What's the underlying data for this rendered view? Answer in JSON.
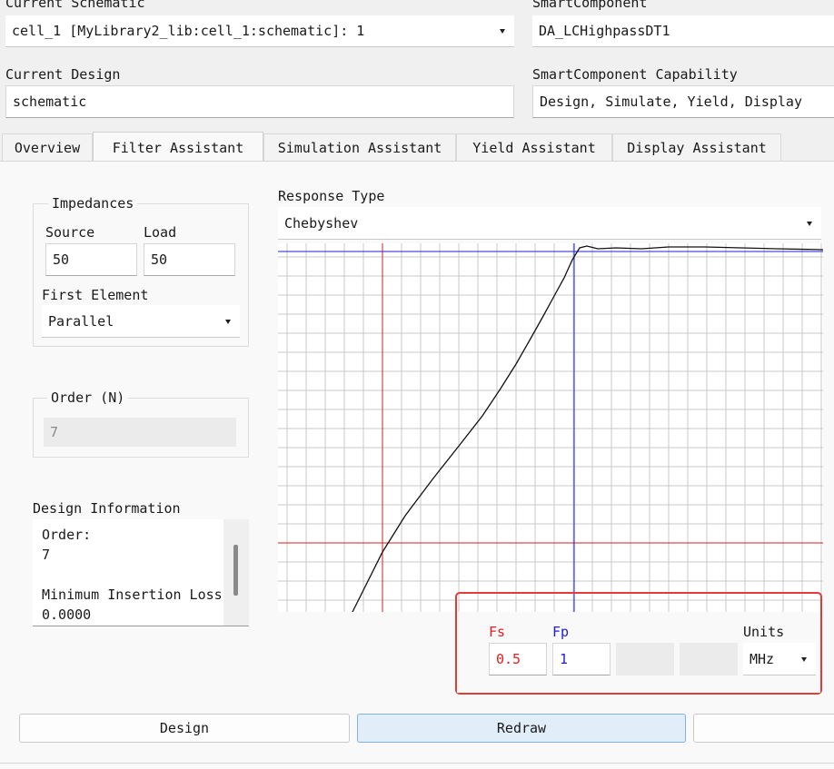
{
  "header": {
    "current_schematic_label": "Current Schematic",
    "current_schematic_value": "cell_1 [MyLibrary2_lib:cell_1:schematic]: 1",
    "smart_component_label": "SmartComponent",
    "smart_component_value": "DA_LCHighpassDT1",
    "current_design_label": "Current Design",
    "current_design_value": "schematic",
    "capability_label": "SmartComponent Capability",
    "capability_value": "Design, Simulate, Yield, Display"
  },
  "tabs": [
    {
      "label": "Overview"
    },
    {
      "label": "Filter Assistant",
      "active": true
    },
    {
      "label": "Simulation Assistant"
    },
    {
      "label": "Yield Assistant"
    },
    {
      "label": "Display Assistant"
    }
  ],
  "impedances": {
    "title": "Impedances",
    "source_label": "Source",
    "source_value": "50",
    "load_label": "Load",
    "load_value": "50",
    "first_element_label": "First Element",
    "first_element_value": "Parallel"
  },
  "order": {
    "title": "Order (N)",
    "value": "7"
  },
  "design_information": {
    "title": "Design Information",
    "lines": [
      "Order:",
      "7",
      "",
      "Minimum Insertion Loss",
      "0.0000"
    ]
  },
  "response": {
    "label": "Response Type",
    "value": "Chebyshev"
  },
  "frequency": {
    "fs_label": "Fs",
    "fs_value": "0.5",
    "fp_label": "Fp",
    "fp_value": "1",
    "units_label": "Units",
    "units_value": "MHz"
  },
  "buttons": {
    "design": "Design",
    "redraw": "Redraw"
  },
  "colors": {
    "fs_red": "#e02020",
    "fp_blue": "#2020d0",
    "highlight_frame": "#e03c3c",
    "redraw_bg": "#e1eef9"
  }
}
